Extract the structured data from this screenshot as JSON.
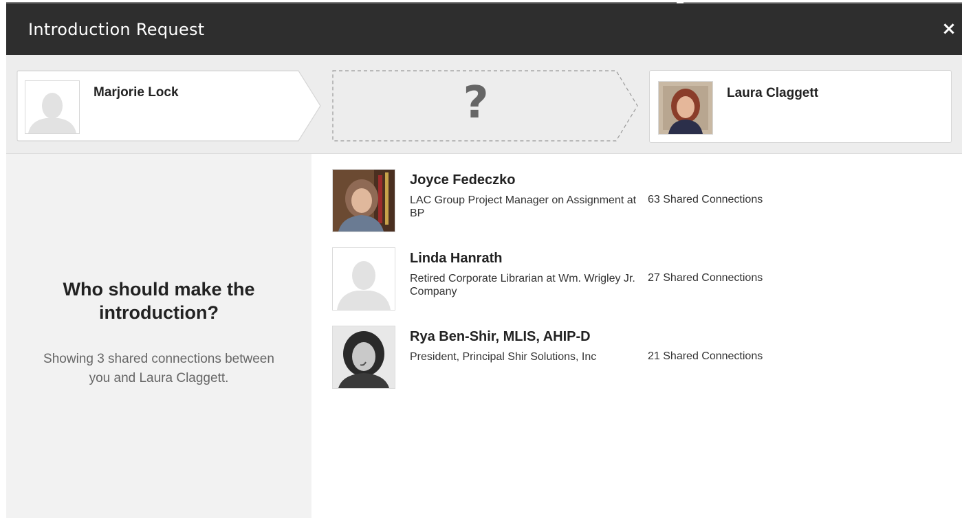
{
  "dialog": {
    "title": "Introduction Request",
    "close_symbol": "×"
  },
  "from_person": {
    "name": "Marjorie Lock",
    "avatar": "default-avatar-icon"
  },
  "middle": {
    "symbol": "?"
  },
  "to_person": {
    "name": "Laura Claggett",
    "avatar": "photo"
  },
  "left_panel": {
    "heading": "Who should make the introduction?",
    "subtext": "Showing 3 shared connections between you and Laura Claggett."
  },
  "connections": [
    {
      "name": "Joyce Fedeczko",
      "title": "LAC Group Project Manager on Assignment at BP",
      "shared": "63 Shared Connections",
      "avatar": "photo"
    },
    {
      "name": "Linda Hanrath",
      "title": "Retired Corporate Librarian at Wm. Wrigley Jr. Company",
      "shared": "27 Shared Connections",
      "avatar": "default-avatar-icon"
    },
    {
      "name": "Rya Ben-Shir, MLIS, AHIP-D",
      "title": "President, Principal Shir Solutions, Inc",
      "shared": "21 Shared Connections",
      "avatar": "photo"
    }
  ],
  "colors": {
    "titlebar": "#2e2e2e",
    "header_band": "#ededed",
    "left_panel": "#f2f2f2",
    "question_mark": "#666666"
  }
}
